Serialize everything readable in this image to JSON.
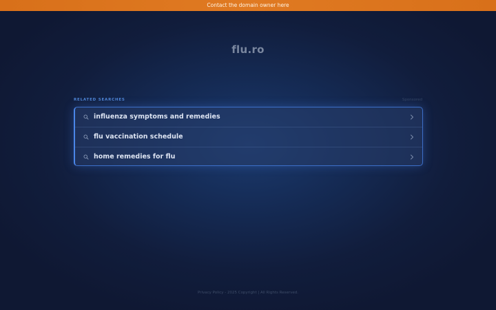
{
  "top_banner": {
    "label": "Contact the domain owner here",
    "color": "#e07a22"
  },
  "domain": {
    "name": "flu.ro"
  },
  "related_searches": {
    "header": "RELATED SEARCHES",
    "sponsored_label": "Sponsored",
    "accent_color": "#4a86e8",
    "items": [
      {
        "label": "influenza symptoms and remedies",
        "icon": "search-icon",
        "trailing_icon": "chevron-right-icon"
      },
      {
        "label": "flu vaccination schedule",
        "icon": "search-icon",
        "trailing_icon": "chevron-right-icon"
      },
      {
        "label": "home remedies for flu",
        "icon": "search-icon",
        "trailing_icon": "chevron-right-icon"
      }
    ]
  },
  "footer": {
    "privacy_label": "Privacy Policy",
    "separator": " - ",
    "copyright": "2025 Copyright | All Rights Reserved."
  }
}
